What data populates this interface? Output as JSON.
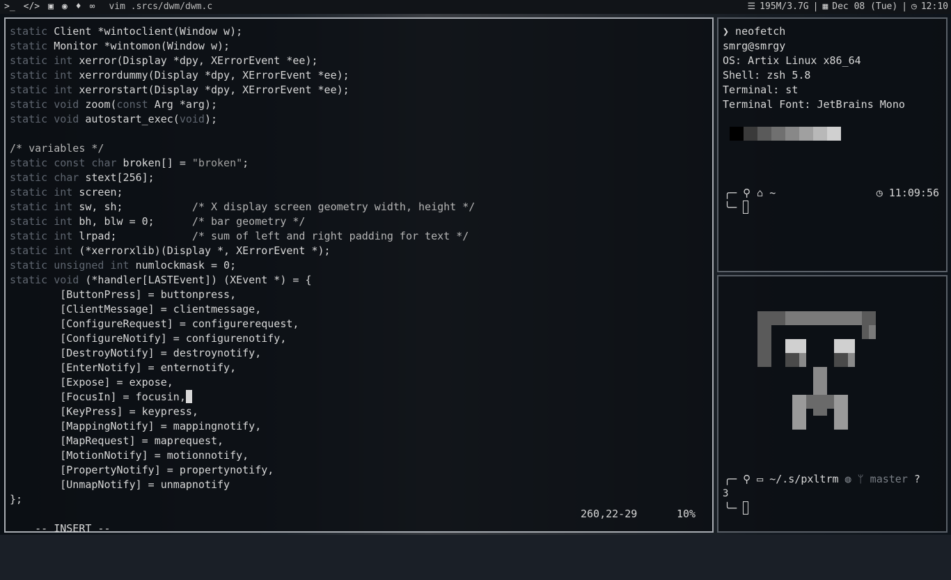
{
  "bar": {
    "icons": [
      "terminal-icon",
      "code-icon",
      "chat-icon",
      "spotify-icon",
      "fire-icon",
      "link-icon"
    ],
    "window_title": "vim .srcs/dwm/dwm.c",
    "memory": "195M/3.7G",
    "date": "Dec 08 (Tue)",
    "time": "12:10"
  },
  "vim": {
    "lines": [
      [
        [
          "kw",
          "static"
        ],
        [
          "",
          " Client *wintoclient(Window w);"
        ]
      ],
      [
        [
          "kw",
          "static"
        ],
        [
          "",
          " Monitor *wintomon(Window w);"
        ]
      ],
      [
        [
          "kw",
          "static int"
        ],
        [
          "",
          " xerror(Display *dpy, XErrorEvent *ee);"
        ]
      ],
      [
        [
          "kw",
          "static int"
        ],
        [
          "",
          " xerrordummy(Display *dpy, XErrorEvent *ee);"
        ]
      ],
      [
        [
          "kw",
          "static int"
        ],
        [
          "",
          " xerrorstart(Display *dpy, XErrorEvent *ee);"
        ]
      ],
      [
        [
          "kw",
          "static void"
        ],
        [
          "",
          " zoom("
        ],
        [
          "kw",
          "const"
        ],
        [
          "",
          " Arg *arg);"
        ]
      ],
      [
        [
          "kw",
          "static void"
        ],
        [
          "",
          " autostart_exec("
        ],
        [
          "kw",
          "void"
        ],
        [
          "",
          ");"
        ]
      ],
      [
        [
          "",
          ""
        ]
      ],
      [
        [
          "cm",
          "/* variables */"
        ]
      ],
      [
        [
          "kw",
          "static const char"
        ],
        [
          "",
          " broken[] = "
        ],
        [
          "st",
          "\"broken\""
        ],
        [
          "",
          ";"
        ]
      ],
      [
        [
          "kw",
          "static char"
        ],
        [
          "",
          " stext[256];"
        ]
      ],
      [
        [
          "kw",
          "static int"
        ],
        [
          "",
          " screen;"
        ]
      ],
      [
        [
          "kw",
          "static int"
        ],
        [
          "",
          " sw, sh;           "
        ],
        [
          "cm",
          "/* X display screen geometry width, height */"
        ]
      ],
      [
        [
          "kw",
          "static int"
        ],
        [
          "",
          " bh, blw = 0;      "
        ],
        [
          "cm",
          "/* bar geometry */"
        ]
      ],
      [
        [
          "kw",
          "static int"
        ],
        [
          "",
          " lrpad;            "
        ],
        [
          "cm",
          "/* sum of left and right padding for text */"
        ]
      ],
      [
        [
          "kw",
          "static int"
        ],
        [
          "",
          " (*xerrorxlib)(Display *, XErrorEvent *);"
        ]
      ],
      [
        [
          "kw",
          "static unsigned int"
        ],
        [
          "",
          " numlockmask = 0;"
        ]
      ],
      [
        [
          "kw",
          "static void"
        ],
        [
          "",
          " (*handler[LASTEvent]) (XEvent *) = {"
        ]
      ],
      [
        [
          "",
          "        [ButtonPress] = buttonpress,"
        ]
      ],
      [
        [
          "",
          "        [ClientMessage] = clientmessage,"
        ]
      ],
      [
        [
          "",
          "        [ConfigureRequest] = configurerequest,"
        ]
      ],
      [
        [
          "",
          "        [ConfigureNotify] = configurenotify,"
        ]
      ],
      [
        [
          "",
          "        [DestroyNotify] = destroynotify,"
        ]
      ],
      [
        [
          "",
          "        [EnterNotify] = enternotify,"
        ]
      ],
      [
        [
          "",
          "        [Expose] = expose,"
        ]
      ],
      [
        [
          "",
          "        [FocusIn] = focusin,"
        ],
        [
          "cursor",
          ""
        ]
      ],
      [
        [
          "",
          "        [KeyPress] = keypress,"
        ]
      ],
      [
        [
          "",
          "        [MappingNotify] = mappingnotify,"
        ]
      ],
      [
        [
          "",
          "        [MapRequest] = maprequest,"
        ]
      ],
      [
        [
          "",
          "        [MotionNotify] = motionnotify,"
        ]
      ],
      [
        [
          "",
          "        [PropertyNotify] = propertynotify,"
        ]
      ],
      [
        [
          "",
          "        [UnmapNotify] = unmapnotify"
        ]
      ],
      [
        [
          "",
          "};"
        ]
      ]
    ],
    "mode": "-- INSERT --",
    "position": "260,22-29",
    "percent": "10%"
  },
  "neofetch": {
    "command": "❯ neofetch",
    "user_host": "smrg@smrgy",
    "os": "OS: Artix Linux x86_64",
    "shell": "Shell: zsh 5.8",
    "terminal": "Terminal: st",
    "font": "Terminal Font: JetBrains Mono",
    "swatches": [
      "#000000",
      "#3a3a3a",
      "#5a5a5a",
      "#707070",
      "#888888",
      "#a0a0a0",
      "#b8b8b8",
      "#d0d0d0"
    ],
    "prompt_path": "~",
    "prompt_time": "11:09:56"
  },
  "pxltrm": {
    "prompt_path": "~/.s/pxltrm",
    "branch": "master",
    "status": "?",
    "status_count": "3"
  }
}
